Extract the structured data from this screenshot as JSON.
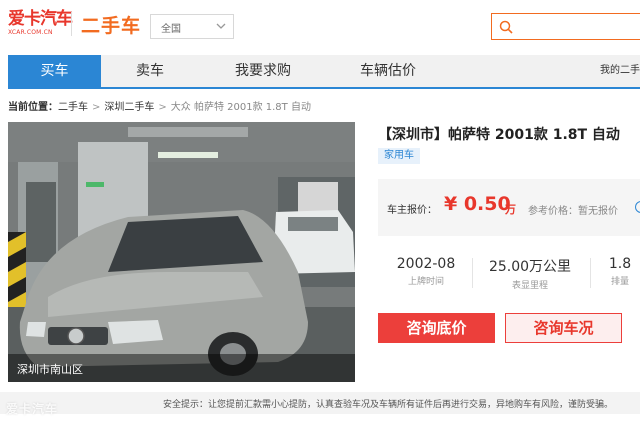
{
  "header": {
    "logo_main": "爱卡汽车",
    "logo_sub": "XCAR.COM.CN",
    "site_title": "二手车",
    "city_select": {
      "value": "全国"
    },
    "search": {
      "placeholder": ""
    }
  },
  "nav": {
    "items": [
      {
        "label": "买车",
        "active": true
      },
      {
        "label": "卖车"
      },
      {
        "label": "我要求购"
      },
      {
        "label": "车辆估价"
      }
    ],
    "right_link": "我的二手"
  },
  "breadcrumb": {
    "label": "当前位置：",
    "items": [
      "二手车",
      "深圳二手车",
      "大众 帕萨特 2001款 1.8T 自动"
    ]
  },
  "listing": {
    "photo_caption": "深圳市南山区",
    "title": "【深圳市】帕萨特 2001款 1.8T 自动",
    "tag": "家用车",
    "price_label": "车主报价：",
    "price_value": "¥ 0.50",
    "price_unit": "万",
    "ref_price": "参考价格：暂无报价",
    "specs": [
      {
        "value": "2002-08",
        "label": "上牌时间"
      },
      {
        "value": "25.00万公里",
        "label": "表显里程"
      },
      {
        "value": "1.8",
        "label": "排量"
      }
    ],
    "buttons": {
      "primary": "咨询底价",
      "secondary": "咨询车况"
    }
  },
  "notice": {
    "text": "安全提示：让您提前汇款需小心提防，认真查验车况及车辆所有证件后再进行交易，异地购车有风险，谨防受骗。"
  },
  "watermark": "爱卡汽车",
  "colors": {
    "brand_red": "#e8372c",
    "brand_orange": "#f26b20",
    "nav_blue": "#2b86d4"
  }
}
